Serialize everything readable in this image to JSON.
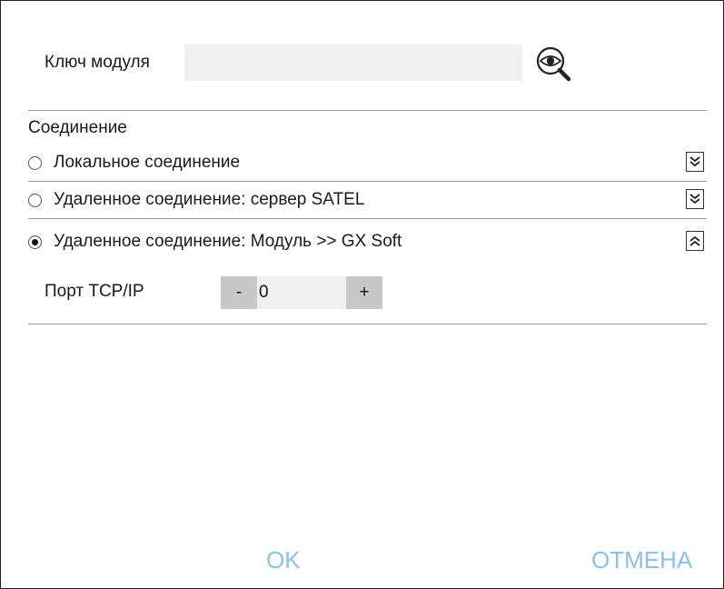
{
  "key": {
    "label": "Ключ модуля",
    "value": ""
  },
  "connection": {
    "title": "Соединение",
    "options": [
      {
        "label": "Локальное соединение",
        "checked": false,
        "expander": "collapsed"
      },
      {
        "label": "Удаленное соединение: сервер SATEL",
        "checked": false,
        "expander": "collapsed"
      },
      {
        "label": "Удаленное соединение: Модуль >> GX Soft",
        "checked": true,
        "expander": "expanded"
      }
    ]
  },
  "port": {
    "label": "Порт TCP/IP",
    "minus": "-",
    "value": "0",
    "plus": "+"
  },
  "footer": {
    "ok": "OK",
    "cancel": "ОТМЕНА"
  },
  "colors": {
    "accent": "#8ec0ec",
    "stepper": "#c8c8c8",
    "input_bg": "#f0f0f0"
  },
  "icons": {
    "reveal": "eye-magnifier-icon",
    "collapsed": "double-chevron-down-icon",
    "expanded": "double-chevron-up-icon"
  }
}
